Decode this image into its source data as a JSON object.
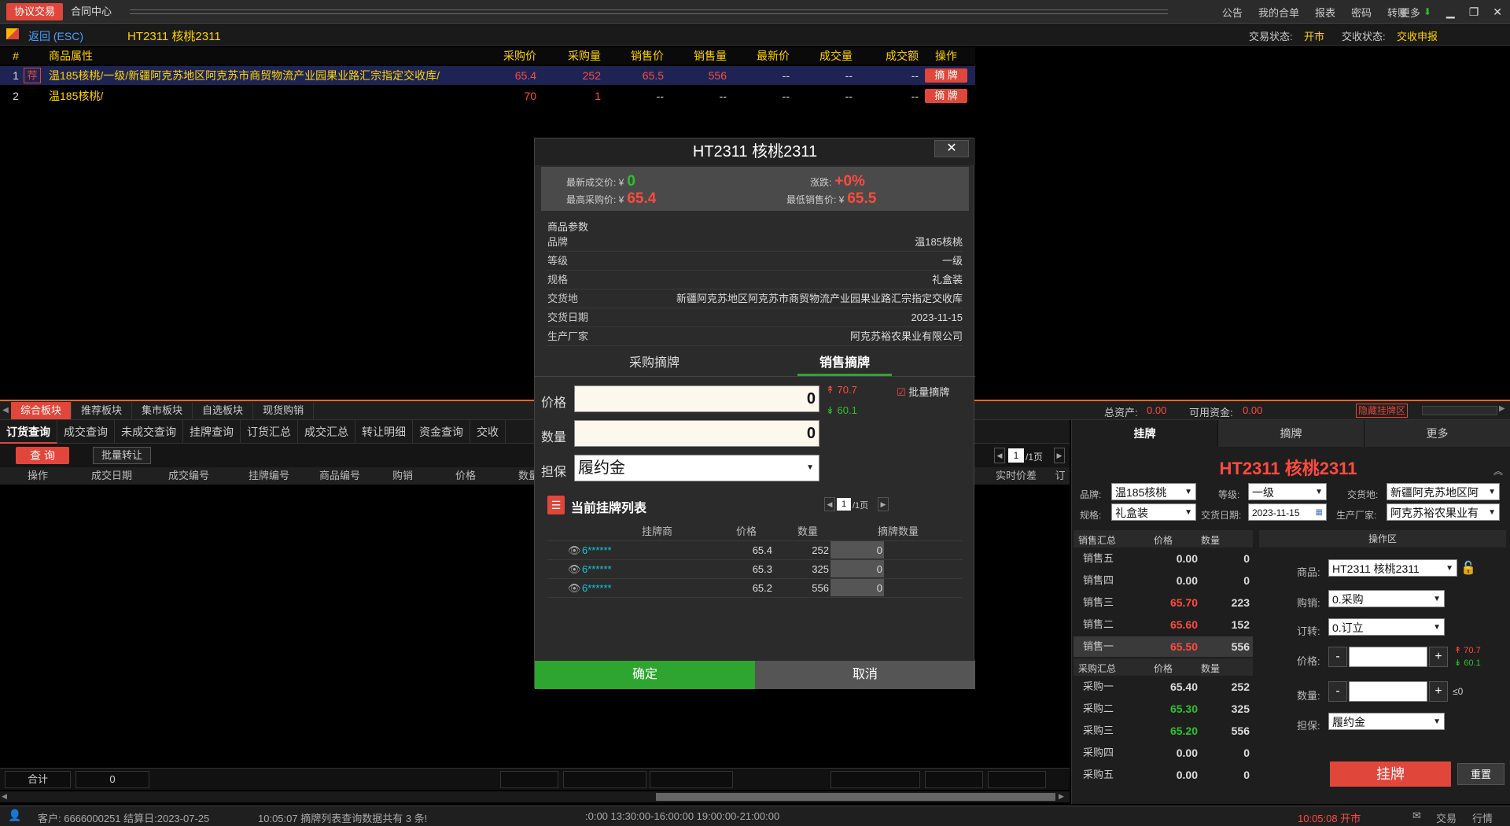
{
  "topbar": {
    "tabs": [
      "协议交易",
      "合同中心"
    ],
    "menu": [
      "公告",
      "我的合单",
      "报表",
      "密码",
      "转账",
      "更多"
    ]
  },
  "subbar": {
    "back": "返回 (ESC)",
    "product": "HT2311 核桃2311",
    "trade_status_label": "交易状态:",
    "trade_status": "开市",
    "delivery_status_label": "交收状态:",
    "delivery_status": "交收申报"
  },
  "list": {
    "headers": [
      "#",
      "商品属性",
      "采购价",
      "采购量",
      "销售价",
      "销售量",
      "最新价",
      "成交量",
      "成交额",
      "操作"
    ],
    "rows": [
      {
        "num": "1",
        "rec": "荐",
        "name": "温185核桃/一级/新疆阿克苏地区阿克苏市商贸物流产业园果业路汇宗指定交收库/",
        "bp": "65.4",
        "bq": "252",
        "sp": "65.5",
        "sq": "556",
        "lt": "--",
        "vol": "--",
        "amt": "--",
        "op": "摘 牌"
      },
      {
        "num": "2",
        "rec": "",
        "name": "温185核桃/",
        "bp": "70",
        "bq": "1",
        "sp": "--",
        "sq": "--",
        "lt": "--",
        "vol": "--",
        "amt": "--",
        "op": "摘 牌"
      }
    ]
  },
  "boardbar": {
    "tabs": [
      "综合板块",
      "推荐板块",
      "集市板块",
      "自选板块",
      "现货购销"
    ],
    "total_assets_label": "总资产:",
    "total_assets": "0.00",
    "avail_label": "可用资金:",
    "avail": "0.00",
    "hide_btn": "隐藏挂牌区"
  },
  "lower": {
    "tabs": [
      "订货查询",
      "成交查询",
      "未成交查询",
      "挂牌查询",
      "订货汇总",
      "成交汇总",
      "转让明细",
      "资金查询",
      "交收"
    ],
    "query_btn": "查 询",
    "batch_btn": "批量转让",
    "page": "1",
    "page_suffix": "/1页",
    "columns": [
      "操作",
      "成交日期",
      "成交编号",
      "挂牌编号",
      "商品编号",
      "购销",
      "价格",
      "数量",
      "实时价差",
      "订"
    ],
    "sum_label": "合计",
    "sum_value": "0"
  },
  "status": {
    "client": "客户: 6666000251 结算日:2023-07-25",
    "message": "10:05:07 摘牌列表查询数据共有 3 条!",
    "sessions": ":0:00   13:30:00-16:00:00   19:00:00-21:00:00",
    "clock": "10:05:08 开市",
    "trade": "交易",
    "quote": "行情"
  },
  "right": {
    "tabs": [
      "挂牌",
      "摘牌",
      "更多"
    ],
    "title": "HT2311 核桃2311",
    "brand_label": "品牌:",
    "brand": "温185核桃",
    "grade_label": "等级:",
    "grade": "一级",
    "place_label": "交货地:",
    "place": "新疆阿克苏地区阿",
    "spec_label": "规格:",
    "spec": "礼盒装",
    "date_label": "交货日期:",
    "date": "2023-11-15",
    "maker_label": "生产厂家:",
    "maker": "阿克苏裕农果业有",
    "sell_head": [
      "销售汇总",
      "价格",
      "数量"
    ],
    "sells": [
      {
        "n": "销售五",
        "p": "0.00",
        "q": "0"
      },
      {
        "n": "销售四",
        "p": "0.00",
        "q": "0"
      },
      {
        "n": "销售三",
        "p": "65.70",
        "q": "223"
      },
      {
        "n": "销售二",
        "p": "65.60",
        "q": "152"
      },
      {
        "n": "销售一",
        "p": "65.50",
        "q": "556"
      }
    ],
    "buy_head": [
      "采购汇总",
      "价格",
      "数量"
    ],
    "buys": [
      {
        "n": "采购一",
        "p": "65.40",
        "q": "252"
      },
      {
        "n": "采购二",
        "p": "65.30",
        "q": "325"
      },
      {
        "n": "采购三",
        "p": "65.20",
        "q": "556"
      },
      {
        "n": "采购四",
        "p": "0.00",
        "q": "0"
      },
      {
        "n": "采购五",
        "p": "0.00",
        "q": "0"
      }
    ],
    "op_title": "操作区",
    "goods_label": "商品:",
    "goods": "HT2311 核桃2311",
    "dir_label": "购销:",
    "dir": "0.采购",
    "transfer_label": "订转:",
    "transfer": "0.订立",
    "price_label": "价格:",
    "qty_label": "数量:",
    "qty_hint": "≤0",
    "guar_label": "担保:",
    "guar": "履约金",
    "limit_up": "70.7",
    "limit_down": "60.1",
    "submit": "挂牌",
    "reset": "重置"
  },
  "modal": {
    "title": "HT2311 核桃2311",
    "close": "✕",
    "last_label": "最新成交价: ¥",
    "last": "0",
    "chg_label": "涨跌:",
    "chg": "+0%",
    "high_buy_label": "最高采购价: ¥",
    "high_buy": "65.4",
    "low_sell_label": "最低销售价: ¥",
    "low_sell": "65.5",
    "params_title": "商品参数",
    "params": [
      {
        "k": "品牌",
        "v": "温185核桃"
      },
      {
        "k": "等级",
        "v": "一级"
      },
      {
        "k": "规格",
        "v": "礼盒装"
      },
      {
        "k": "交货地",
        "v": "新疆阿克苏地区阿克苏市商贸物流产业园果业路汇宗指定交收库"
      },
      {
        "k": "交货日期",
        "v": "2023-11-15"
      },
      {
        "k": "生产厂家",
        "v": "阿克苏裕农果业有限公司"
      }
    ],
    "tab_buy": "采购摘牌",
    "tab_sell": "销售摘牌",
    "price_label": "价格",
    "price": "0",
    "qty_label": "数量",
    "qty": "0",
    "guar_label": "担保",
    "guar": "履约金",
    "limit_up": "70.7",
    "limit_down": "60.1",
    "batch": "批量摘牌",
    "list_title": "当前挂牌列表",
    "page": "1",
    "page_suffix": "/1页",
    "list_head": [
      "挂牌商",
      "价格",
      "数量",
      "摘牌数量"
    ],
    "list_rows": [
      {
        "who": "6******",
        "p": "65.4",
        "q": "252",
        "t": "0"
      },
      {
        "who": "6******",
        "p": "65.3",
        "q": "325",
        "t": "0"
      },
      {
        "who": "6******",
        "p": "65.2",
        "q": "556",
        "t": "0"
      }
    ],
    "ok": "确定",
    "cancel": "取消"
  }
}
